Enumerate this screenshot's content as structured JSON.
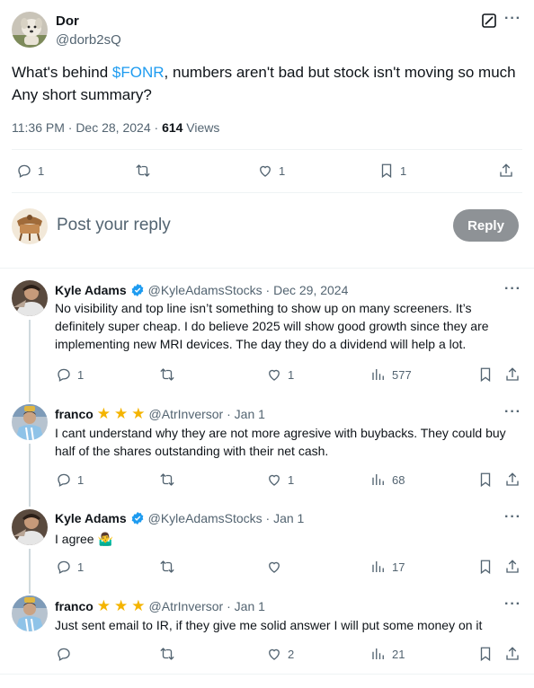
{
  "main_tweet": {
    "author_name": "Dor",
    "author_handle": "@dorb2sQ",
    "text_before_cashtag": "What's behind ",
    "cashtag": "$FONR",
    "text_after_cashtag": ", numbers aren't bad but stock isn't moving so much Any short summary?",
    "time": "11:36 PM · Dec 28, 2024 · ",
    "views_count": "614",
    "views_label": " Views",
    "stats": {
      "replies": "1",
      "retweets": "",
      "likes": "1",
      "bookmarks": "1"
    }
  },
  "reply_box": {
    "placeholder": "Post your reply",
    "button_label": "Reply"
  },
  "replies": [
    {
      "name": "Kyle Adams",
      "verified": true,
      "stars": 0,
      "handle_date": "@KyleAdamsStocks · Dec 29, 2024",
      "text": "No visibility and top line isn’t something to show up on many screeners. It’s definitely super cheap. I do believe 2025 will show good growth since they are implementing new MRI devices. The day they do a dividend will help a lot.",
      "stats": {
        "replies": "1",
        "retweets": "",
        "likes": "1",
        "views": "577"
      }
    },
    {
      "name": "franco",
      "verified": false,
      "stars": 3,
      "handle_date": "@AtrInversor · Jan 1",
      "text": "I cant understand why they are not more agresive with buybacks. They could buy half of the shares outstanding with their net cash.",
      "stats": {
        "replies": "1",
        "retweets": "",
        "likes": "1",
        "views": "68"
      }
    },
    {
      "name": "Kyle Adams",
      "verified": true,
      "stars": 0,
      "handle_date": "@KyleAdamsStocks · Jan 1",
      "text": "I agree 🤷‍♂️",
      "stats": {
        "replies": "1",
        "retweets": "",
        "likes": "",
        "views": "17"
      }
    },
    {
      "name": "franco",
      "verified": false,
      "stars": 3,
      "handle_date": "@AtrInversor · Jan 1",
      "text": "Just sent email to IR, if they give me solid answer I will put some money on it",
      "stats": {
        "replies": "",
        "retweets": "",
        "likes": "2",
        "views": "21"
      }
    }
  ],
  "colors": {
    "link": "#1d9bf0",
    "muted": "#536471",
    "star": "#f4b400",
    "reply_button": "#8e9296"
  },
  "icons": [
    "grok-icon",
    "more-icon",
    "reply-icon",
    "retweet-icon",
    "like-icon",
    "bookmark-icon",
    "share-icon",
    "views-icon",
    "verified-icon",
    "star-icon"
  ]
}
